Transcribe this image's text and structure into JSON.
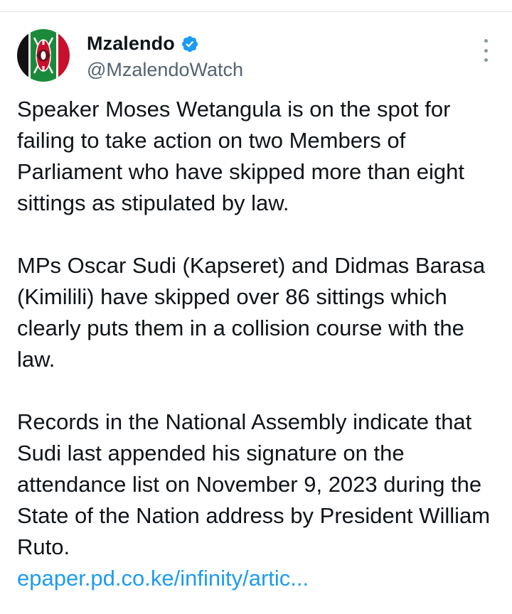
{
  "tweet": {
    "display_name": "Mzalendo",
    "handle": "@MzalendoWatch",
    "verified": true,
    "avatar_icon": "kenya-flag-shield-icon",
    "more_icon": "more-vertical-icon",
    "paragraphs": [
      "Speaker Moses Wetangula is on the spot for failing to take action on two Members of Parliament who have skipped more than eight sittings as stipulated by law.",
      "MPs Oscar Sudi (Kapseret) and Didmas Barasa (Kimilili) have skipped over 86 sittings which clearly puts them in a collision course with the law.",
      "Records in the National Assembly indicate that Sudi last appended his signature on the attendance list on November 9, 2023 during the State of the Nation address by President William Ruto."
    ],
    "link_text": "epaper.pd.co.ke/infinity/artic..."
  },
  "colors": {
    "link": "#1d9bf0",
    "verified_badge": "#1d9bf0",
    "handle": "#536471",
    "text": "#0f1419"
  }
}
